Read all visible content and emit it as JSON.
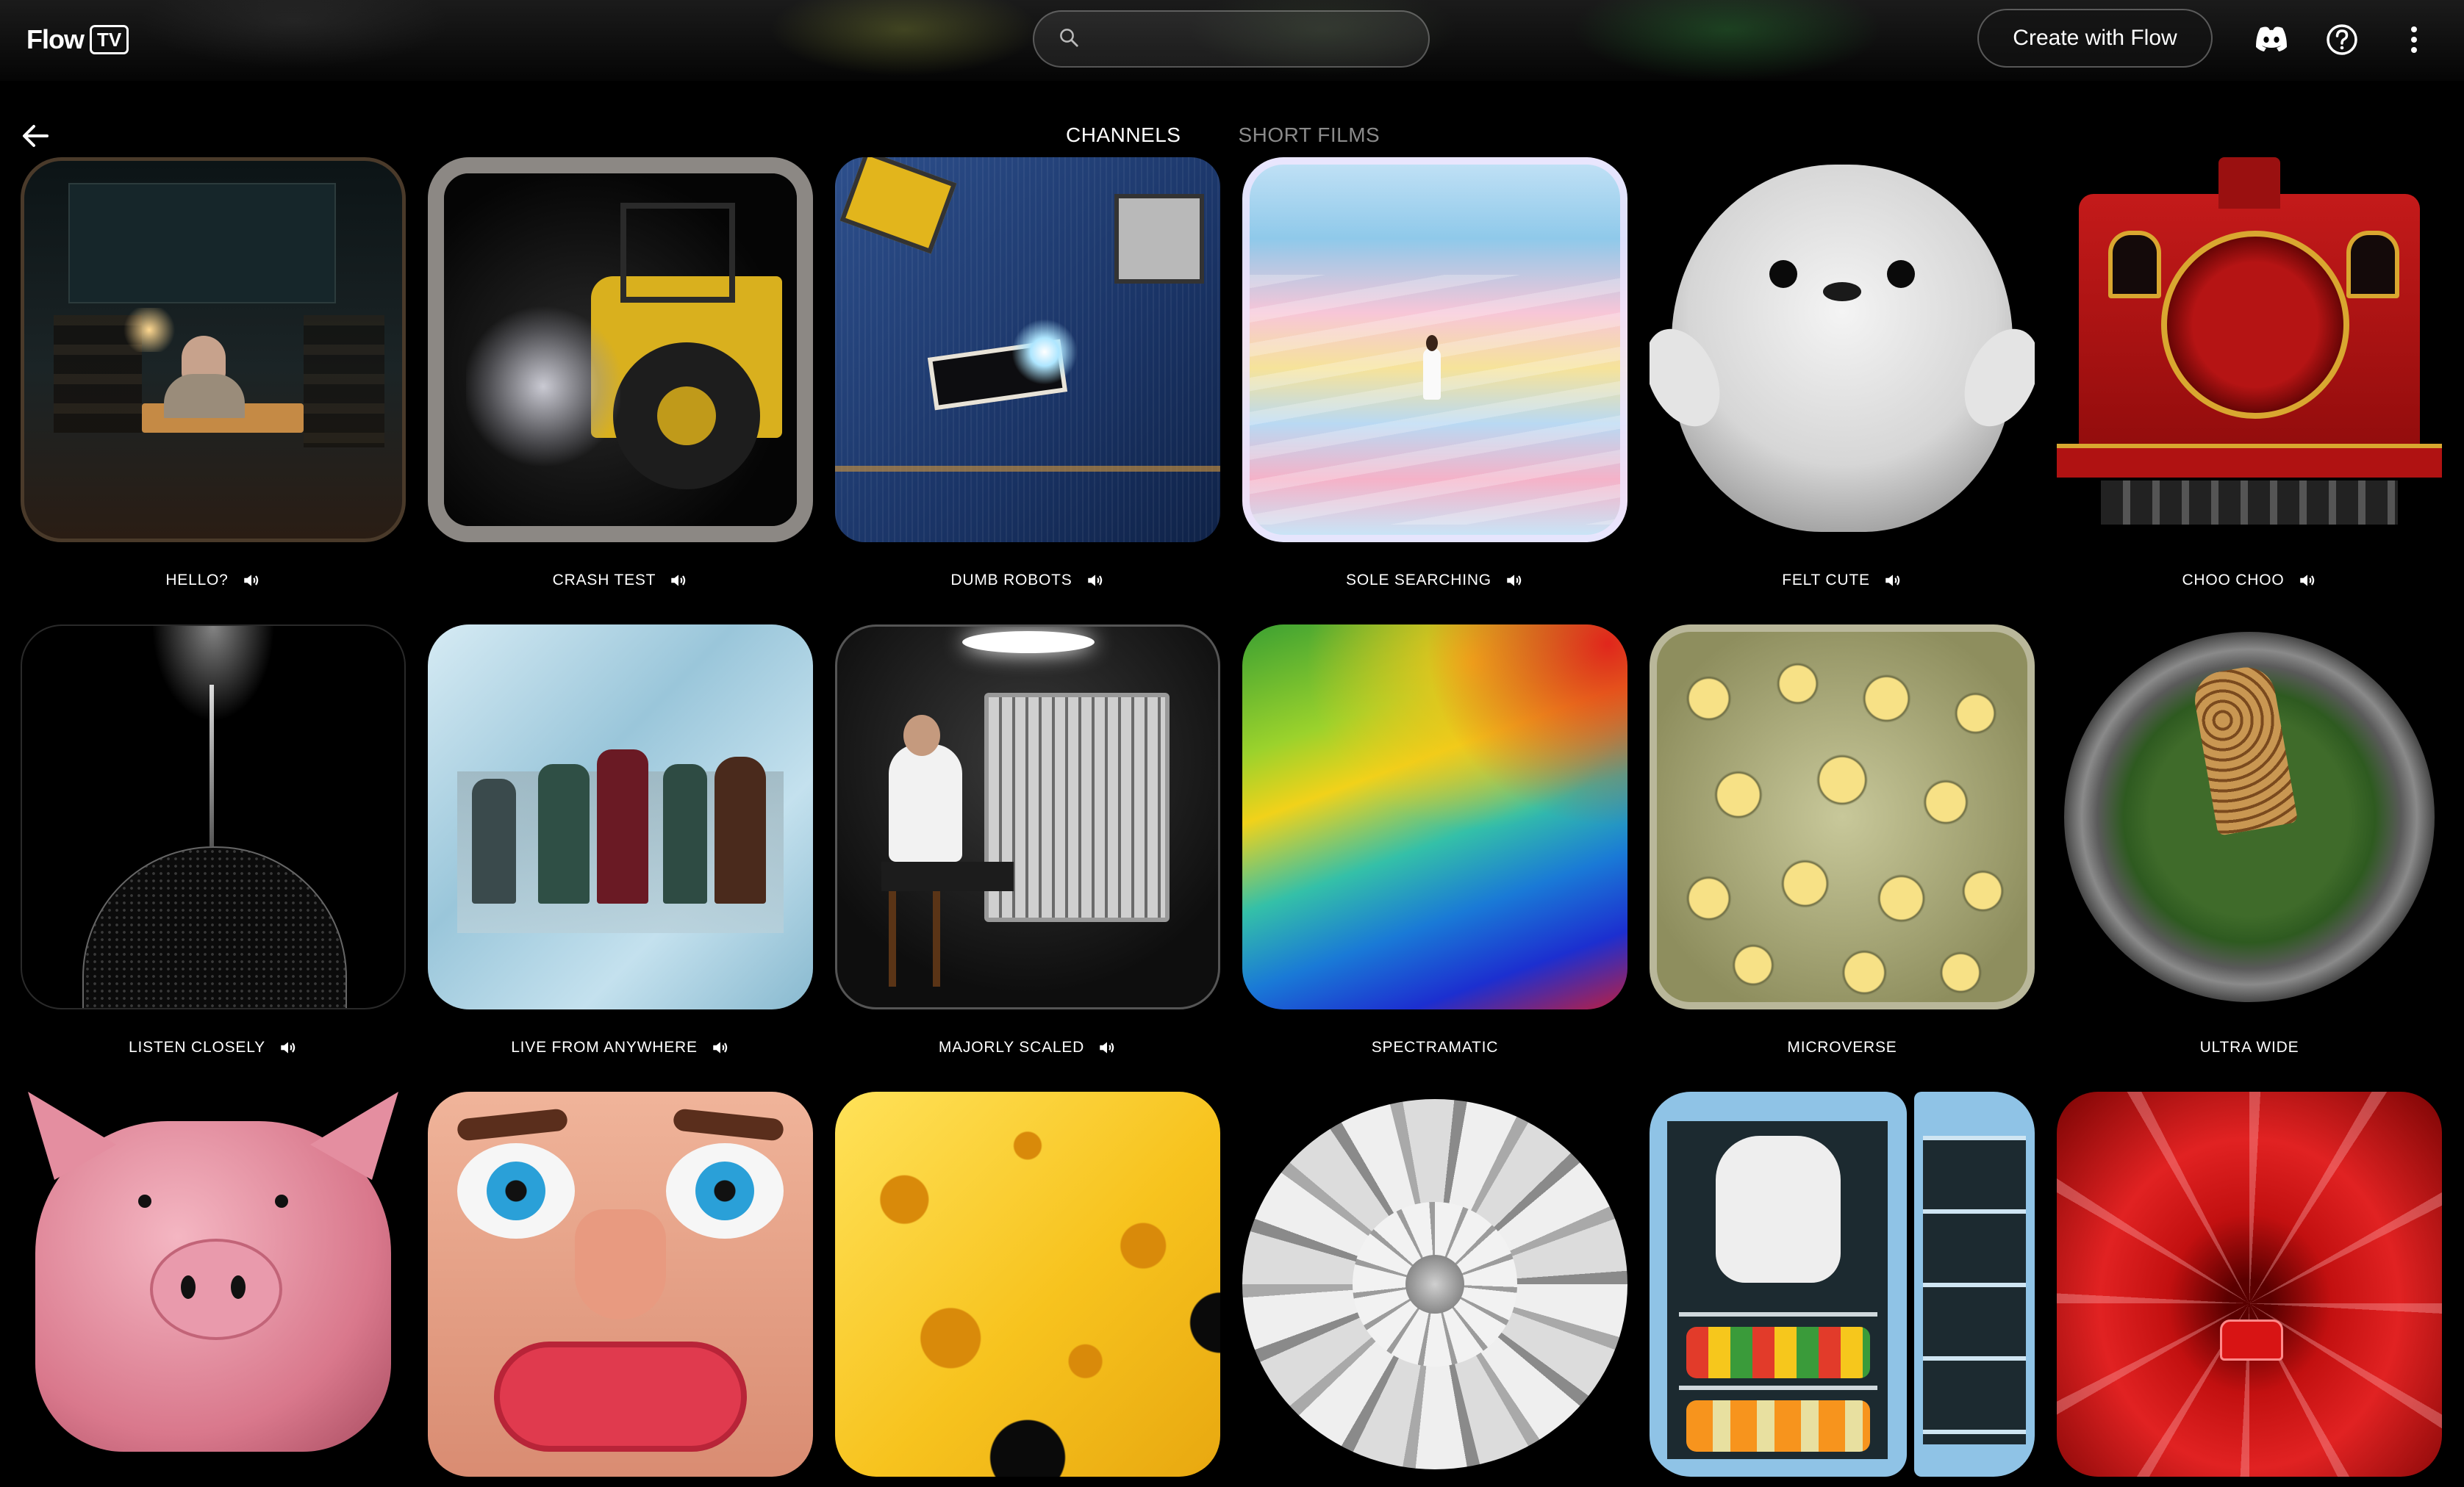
{
  "header": {
    "logo_text": "Flow",
    "logo_badge": "TV",
    "search_placeholder": "",
    "create_button": "Create with Flow",
    "icons": [
      "discord-icon",
      "help-icon",
      "more-vert-icon"
    ]
  },
  "nav": {
    "back_icon": "arrow-back-icon",
    "tabs": [
      {
        "label": "CHANNELS",
        "active": true
      },
      {
        "label": "SHORT FILMS",
        "active": false
      }
    ]
  },
  "channels": [
    {
      "title": "HELLO?",
      "sound": true
    },
    {
      "title": "CRASH TEST",
      "sound": true
    },
    {
      "title": "DUMB ROBOTS",
      "sound": true
    },
    {
      "title": "SOLE SEARCHING",
      "sound": true
    },
    {
      "title": "FELT CUTE",
      "sound": true
    },
    {
      "title": "CHOO CHOO",
      "sound": true
    },
    {
      "title": "LISTEN CLOSELY",
      "sound": true
    },
    {
      "title": "LIVE FROM ANYWHERE",
      "sound": true
    },
    {
      "title": "MAJORLY SCALED",
      "sound": true
    },
    {
      "title": "SPECTRAMATIC",
      "sound": false
    },
    {
      "title": "MICROVERSE",
      "sound": false
    },
    {
      "title": "ULTRA WIDE",
      "sound": false
    },
    {
      "title": "",
      "sound": false
    },
    {
      "title": "",
      "sound": false
    },
    {
      "title": "",
      "sound": false
    },
    {
      "title": "",
      "sound": false
    },
    {
      "title": "",
      "sound": false
    },
    {
      "title": "",
      "sound": false
    }
  ],
  "colors": {
    "background": "#000000",
    "tab_active": "#ffffff",
    "tab_inactive": "#8a8a8a"
  }
}
